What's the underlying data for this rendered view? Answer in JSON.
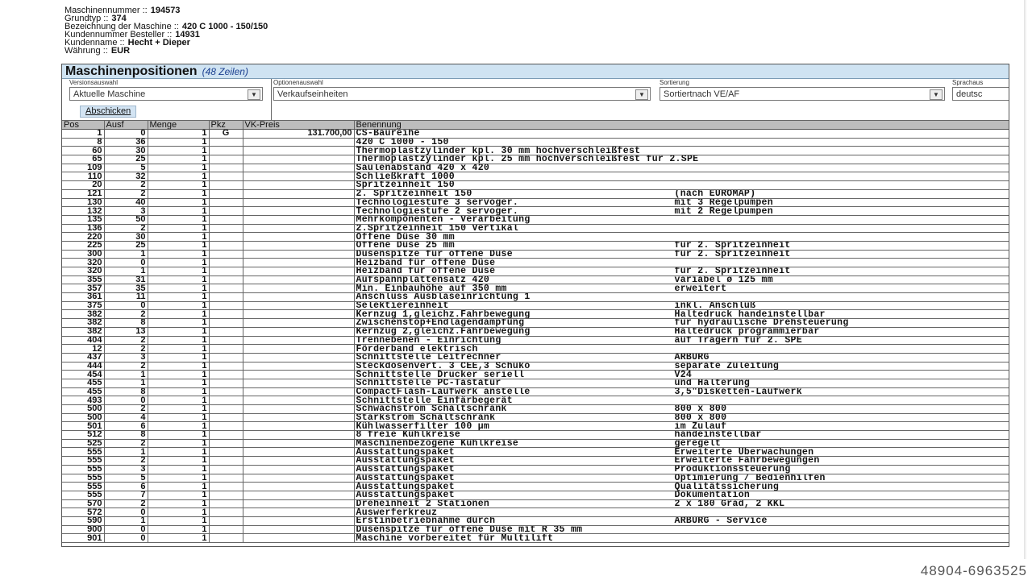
{
  "header": [
    {
      "label": "Maschinennummer ::",
      "value": "194573"
    },
    {
      "label": "Grundtyp ::",
      "value": "374"
    },
    {
      "label": "Bezeichnung der Maschine ::",
      "value": "420 C 1000 - 150/150"
    },
    {
      "label": "Kundennummer Besteller ::",
      "value": "14931"
    },
    {
      "label": "Kundenname ::",
      "value": "Hecht + Dieper"
    },
    {
      "label": "Währung ::",
      "value": "EUR"
    }
  ],
  "panel": {
    "title": "Maschinenpositionen",
    "count": "(48 Zeilen)"
  },
  "options": {
    "version": {
      "label": "Versionsauswahl",
      "value": "Aktuelle Maschine"
    },
    "option": {
      "label": "Optionenauswahl",
      "value": "Verkaufseinheiten"
    },
    "sort": {
      "label": "Sortierung",
      "value": "Sortiertnach VE/AF"
    },
    "lang": {
      "label": "Sprachaus",
      "value": "deutsc"
    },
    "submit": "Abschicken"
  },
  "columns": [
    "Pos",
    "Ausf",
    "Menge",
    "Pkz",
    "VK-Preis",
    "Benennung"
  ],
  "rows": [
    [
      "1",
      "0",
      "1",
      "G",
      "131.700,00",
      "CS-Baureihe",
      ""
    ],
    [
      "8",
      "36",
      "1",
      "",
      "",
      "420 C 1000 - 150",
      ""
    ],
    [
      "60",
      "30",
      "1",
      "",
      "",
      "Thermoplastzylinder kpl. 30 mm hochverschleißfest",
      ""
    ],
    [
      "65",
      "25",
      "1",
      "",
      "",
      "Thermoplastzylinder kpl. 25 mm hochverschleißfest für 2.SPE",
      ""
    ],
    [
      "109",
      "5",
      "1",
      "",
      "",
      "Säulenabstand 420 x 420",
      ""
    ],
    [
      "110",
      "32",
      "1",
      "",
      "",
      "Schließkraft 1000",
      ""
    ],
    [
      "20",
      "2",
      "1",
      "",
      "",
      "Spritzeinheit  150",
      ""
    ],
    [
      "121",
      "2",
      "1",
      "",
      "",
      "2. Spritzeinheit 150",
      "(nach EUROMAP)"
    ],
    [
      "130",
      "40",
      "1",
      "",
      "",
      "Technologiestufe 3 servoger.",
      "mit 3 Regelpumpen"
    ],
    [
      "132",
      "3",
      "1",
      "",
      "",
      "Technologiestufe 2 servoger.",
      "mit 2 Regelpumpen"
    ],
    [
      "135",
      "50",
      "1",
      "",
      "",
      "Mehrkomponenten - Verarbeitung",
      ""
    ],
    [
      "136",
      "2",
      "1",
      "",
      "",
      "2.Spritzeinheit 150 Vertikal",
      ""
    ],
    [
      "220",
      "30",
      "1",
      "",
      "",
      "Offene Düse 30 mm",
      ""
    ],
    [
      "225",
      "25",
      "1",
      "",
      "",
      "Offene Düse 25  mm",
      "für 2. Spritzeinheit"
    ],
    [
      "300",
      "1",
      "1",
      "",
      "",
      "Düsenspitze für offene Düse",
      "für 2. Spritzeinheit"
    ],
    [
      "320",
      "0",
      "1",
      "",
      "",
      "Heizband für offene Düse",
      ""
    ],
    [
      "320",
      "1",
      "1",
      "",
      "",
      "Heizband für offene Düse",
      "für 2. Spritzeinheit"
    ],
    [
      "355",
      "31",
      "1",
      "",
      "",
      "Aufspannplattensatz 420",
      "variabel ø 125 mm"
    ],
    [
      "357",
      "35",
      "1",
      "",
      "",
      "Min. Einbauhöhe auf 350 mm",
      "erweitert"
    ],
    [
      "361",
      "11",
      "1",
      "",
      "",
      "Anschluss Ausblaseinrichtung 1",
      ""
    ],
    [
      "375",
      "0",
      "1",
      "",
      "",
      "Selektiereinheit",
      "inkl. Anschluß"
    ],
    [
      "382",
      "2",
      "1",
      "",
      "",
      "Kernzug 1,gleichz.Fahrbewegung",
      "Haltedruck handeinstellbar"
    ],
    [
      "382",
      "8",
      "1",
      "",
      "",
      "Zwischenstop+Endlagendämpfung",
      "für hydraulische Drehsteuerung"
    ],
    [
      "382",
      "13",
      "1",
      "",
      "",
      "Kernzug 2,gleichz.Fahrbewegung",
      "Haltedruck programmierbar"
    ],
    [
      "404",
      "2",
      "1",
      "",
      "",
      "Trennebenen - Einrichtung",
      "auf Trägern für 2. SPE"
    ],
    [
      "12",
      "2",
      "1",
      "",
      "",
      "Förderband elektrisch",
      ""
    ],
    [
      "437",
      "3",
      "1",
      "",
      "",
      "Schnittstelle Leitrechner",
      "ARBURG"
    ],
    [
      "444",
      "2",
      "1",
      "",
      "",
      "Steckdosenvert. 3 CEE,3 Schuko",
      "separate Zuleitung"
    ],
    [
      "454",
      "1",
      "1",
      "",
      "",
      "Schnittstelle Drucker seriell",
      "V24"
    ],
    [
      "455",
      "1",
      "1",
      "",
      "",
      "Schnittstelle PC-Tastatur",
      "und Halterung"
    ],
    [
      "455",
      "8",
      "1",
      "",
      "",
      "CompactFlash-Laufwerk anstelle",
      "3,5\"Disketten-Laufwerk"
    ],
    [
      "493",
      "0",
      "1",
      "",
      "",
      "Schnittstelle Einfärbegerät",
      ""
    ],
    [
      "500",
      "2",
      "1",
      "",
      "",
      "Schwachstrom Schaltschrank",
      "800 x 800"
    ],
    [
      "500",
      "4",
      "1",
      "",
      "",
      "Starkstrom Schaltschrank",
      "800 x 800"
    ],
    [
      "501",
      "6",
      "1",
      "",
      "",
      "Kühlwasserfilter 100 µm",
      "im Zulauf"
    ],
    [
      "512",
      "8",
      "1",
      "",
      "",
      "  8 freie Kühlkreise",
      "handeinstellbar"
    ],
    [
      "525",
      "2",
      "1",
      "",
      "",
      "Maschinenbezogene Kühlkreise",
      "geregelt"
    ],
    [
      "555",
      "1",
      "1",
      "",
      "",
      "Ausstattungspaket",
      "Erweiterte Überwachungen"
    ],
    [
      "555",
      "2",
      "1",
      "",
      "",
      "Ausstattungspaket",
      "Erweiterte Fahrbewegungen"
    ],
    [
      "555",
      "3",
      "1",
      "",
      "",
      "Ausstattungspaket",
      "Produktionssteuerung"
    ],
    [
      "555",
      "5",
      "1",
      "",
      "",
      "Ausstattungspaket",
      "Optimierung / Bedienhilfen"
    ],
    [
      "555",
      "6",
      "1",
      "",
      "",
      "Ausstattungspaket",
      "Qualitätssicherung"
    ],
    [
      "555",
      "7",
      "1",
      "",
      "",
      "Ausstattungspaket",
      "Dokumentation"
    ],
    [
      "570",
      "2",
      "1",
      "",
      "",
      "Dreheinheit  2 Stationen",
      "2 x 180 Grad, 2 KKL"
    ],
    [
      "572",
      "0",
      "1",
      "",
      "",
      "Auswerferkreuz",
      ""
    ],
    [
      "590",
      "1",
      "1",
      "",
      "",
      "Erstinbetriebnahme durch",
      "ARBURG - Service"
    ],
    [
      "900",
      "0",
      "1",
      "",
      "",
      "Düsenspitze für offene Düse mit R 35 mm",
      ""
    ],
    [
      "901",
      "0",
      "1",
      "",
      "",
      "Maschine vorbereitet für Multilift",
      ""
    ]
  ],
  "footer_id": "48904-6963525"
}
